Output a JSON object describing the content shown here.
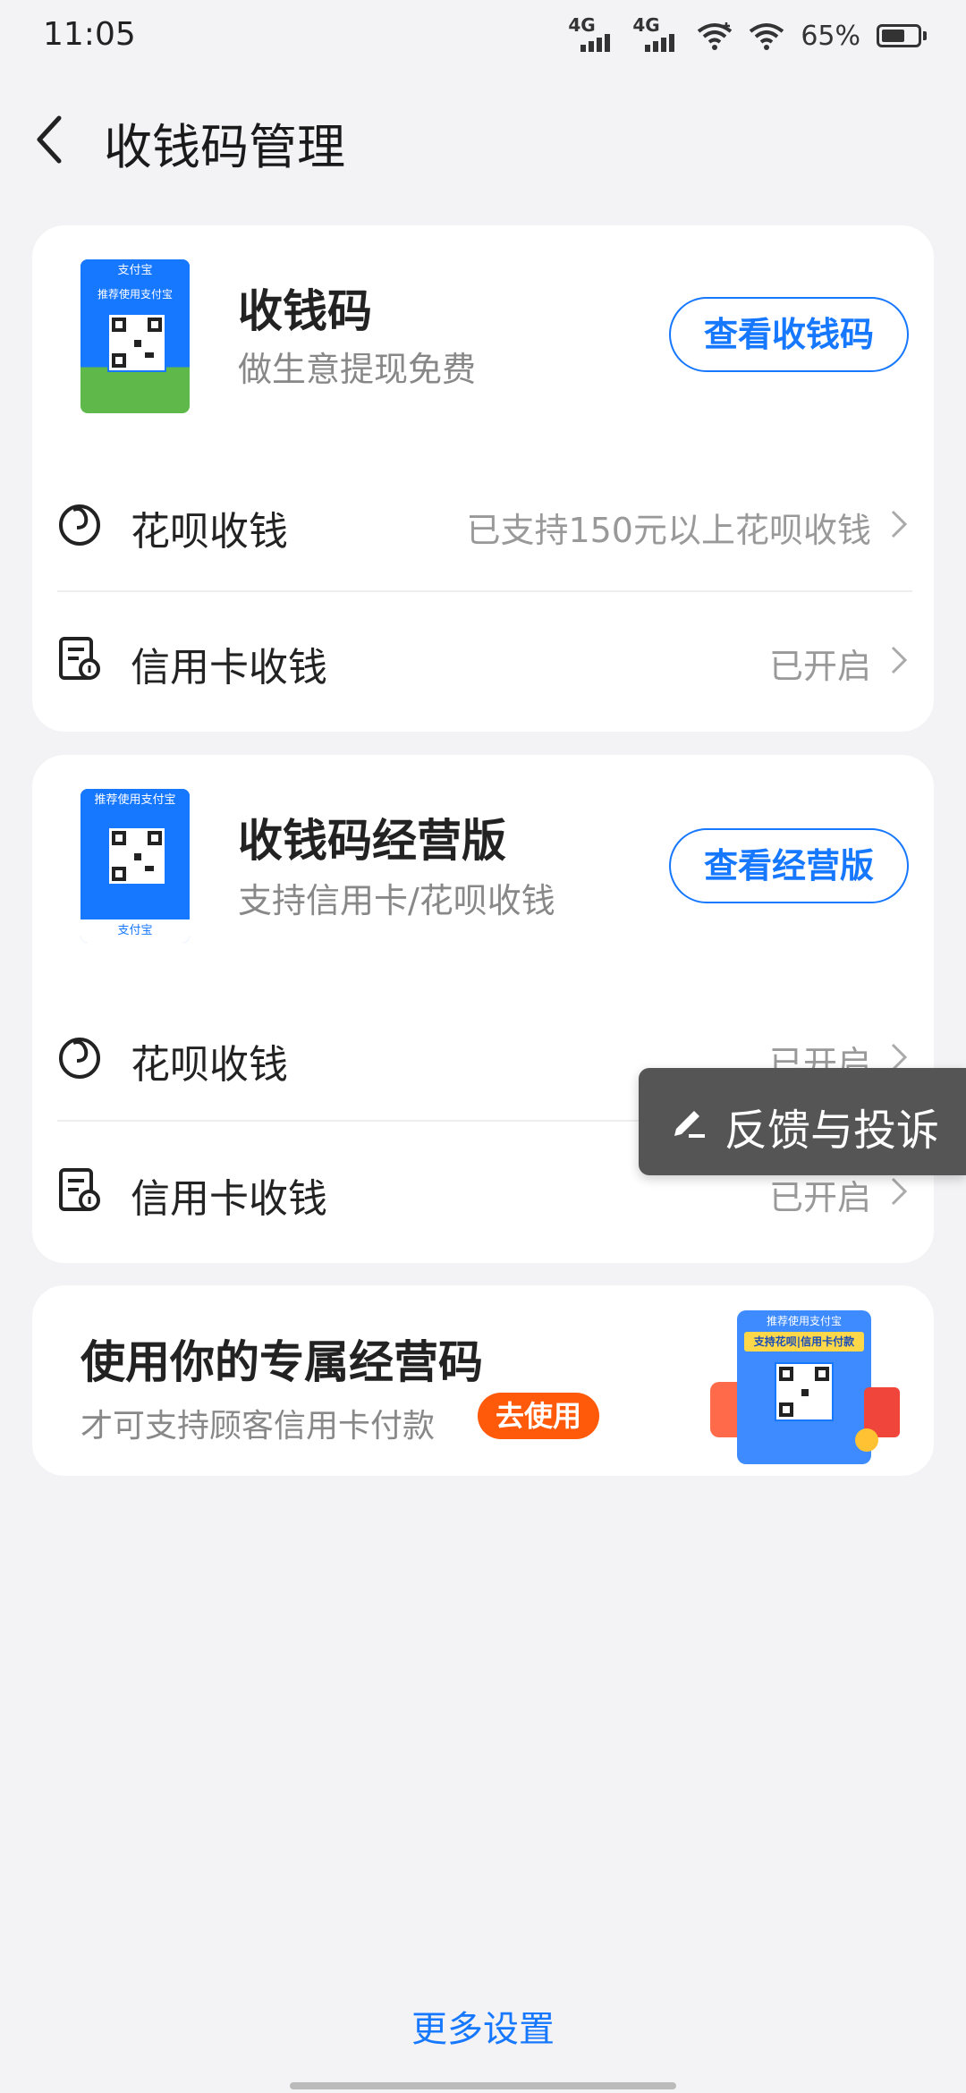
{
  "status": {
    "time": "11:05",
    "sig1": "4G",
    "sig2": "4G",
    "battery": "65%",
    "battery_level": 0.65
  },
  "nav": {
    "title": "收钱码管理"
  },
  "card1": {
    "thumb_header": "推荐使用支付宝",
    "thumb_brand": "支付宝",
    "title": "收钱码",
    "subtitle": "做生意提现免费",
    "button": "查看收钱码",
    "rows": [
      {
        "label": "花呗收钱",
        "value": "已支持150元以上花呗收钱",
        "icon": "huabei-icon"
      },
      {
        "label": "信用卡收钱",
        "value": "已开启",
        "icon": "credit-card-doc-icon"
      }
    ]
  },
  "card2": {
    "thumb_header": "推荐使用支付宝",
    "thumb_brand": "支付宝",
    "title": "收钱码经营版",
    "subtitle": "支持信用卡/花呗收钱",
    "button": "查看经营版",
    "rows": [
      {
        "label": "花呗收钱",
        "value": "已开启",
        "icon": "huabei-icon"
      },
      {
        "label": "信用卡收钱",
        "value": "已开启",
        "icon": "credit-card-doc-icon"
      }
    ]
  },
  "promo": {
    "title": "使用你的专属经营码",
    "subtitle": "才可支持顾客信用卡付款",
    "button": "去使用",
    "art_header": "推荐使用支付宝",
    "art_banner": "支持花呗|信用卡付款"
  },
  "float": {
    "label": "反馈与投诉",
    "icon": "edit-icon"
  },
  "footer": {
    "more": "更多设置"
  },
  "colors": {
    "accent": "#1677ff",
    "promo": "#ff5a0a",
    "background": "#f3f3f5"
  }
}
